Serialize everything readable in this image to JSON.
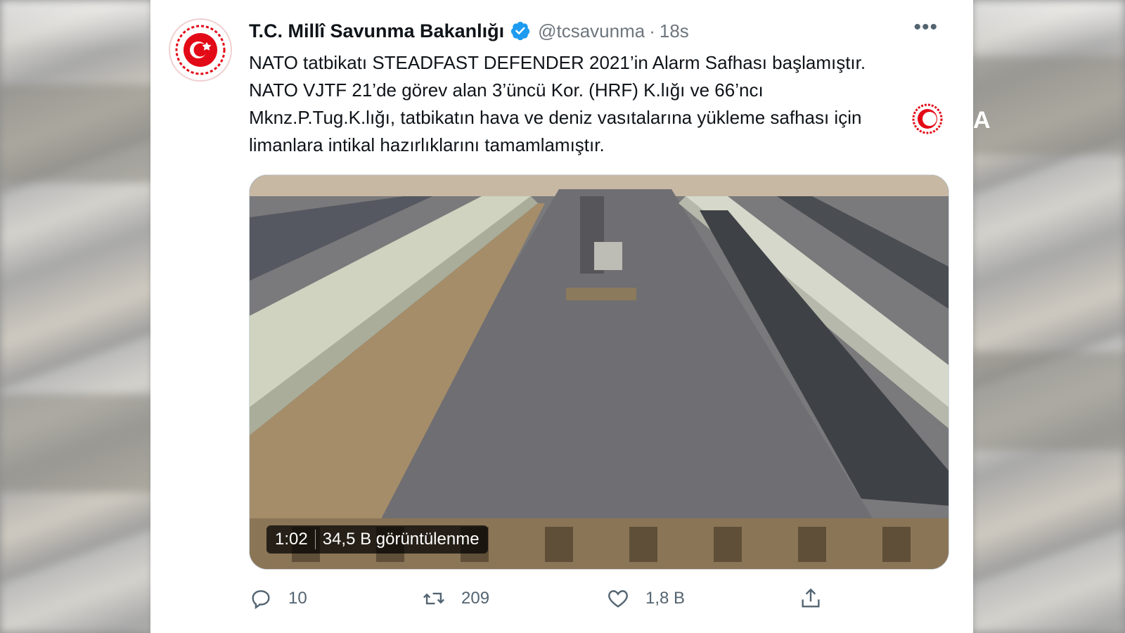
{
  "tweet": {
    "display_name": "T.C. Millî Savunma Bakanlığı",
    "handle": "@tcsavunma",
    "separator": "·",
    "time": "18s",
    "more_icon": "more-horizontal-icon",
    "verified_icon": "verified-badge-icon",
    "text_lines": [
      "NATO tatbikatı STEADFAST DEFENDER 2021’in Alarm Safhası başlamıştır.",
      "NATO VJTF 21’de görev alan 3’üncü Kor. (HRF) K.lığı ve 66’ncı",
      "Mknz.P.Tug.K.lığı, tatbikatın hava ve deniz vasıtalarına yükleme safhası için",
      "limanlara intikal hazırlıklarını tamamlamıştır."
    ],
    "video": {
      "duration": "1:02",
      "views": "34,5 B görüntülenme"
    },
    "actions": {
      "reply": {
        "icon": "reply-icon",
        "count": "10"
      },
      "retweet": {
        "icon": "retweet-icon",
        "count": "209"
      },
      "like": {
        "icon": "heart-icon",
        "count": "1,8 B"
      },
      "share": {
        "icon": "share-icon"
      }
    }
  },
  "overlay": {
    "watermark_tail": "A"
  },
  "colors": {
    "text": "#0f1419",
    "secondary": "#536471",
    "verified": "#1d9bf0",
    "emblem_red": "#e30a17"
  }
}
